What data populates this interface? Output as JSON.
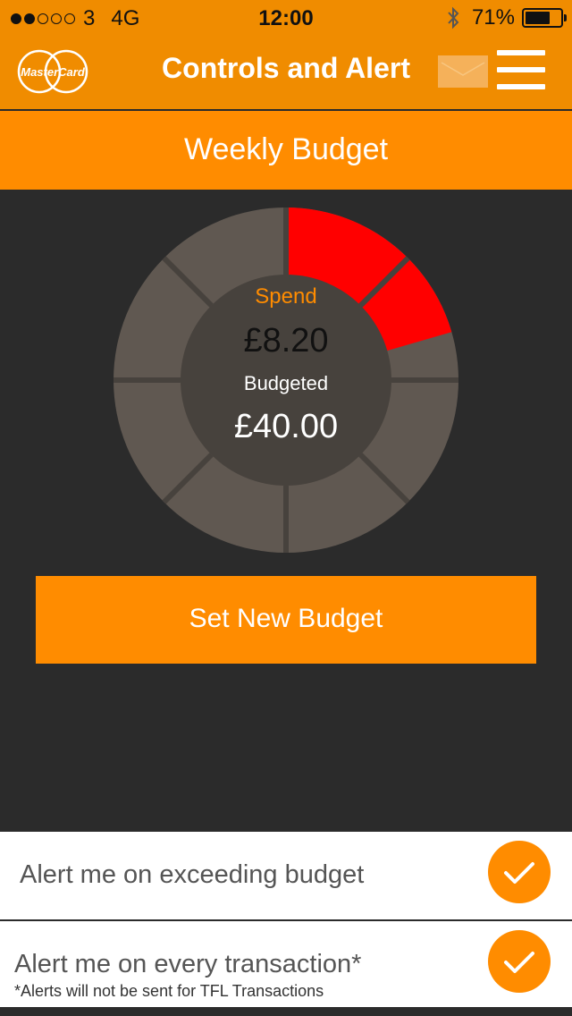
{
  "status_bar": {
    "signal_dots_filled": 2,
    "signal_dots_total": 5,
    "carrier": "3",
    "network": "4G",
    "time": "12:00",
    "battery": "71%",
    "battery_level": 0.71,
    "bluetooth_icon": "bluetooth-icon"
  },
  "header": {
    "logo_text": "MasterCard",
    "title": "Controls and Alert",
    "envelope_icon": "envelope-icon",
    "menu_icon": "hamburger-menu-icon"
  },
  "budget": {
    "section_title": "Weekly Budget",
    "spend_label": "Spend",
    "spend_value": "£8.20",
    "budget_label": "Budgeted",
    "budget_value": "£40.00",
    "spend_fraction": 0.205,
    "colors": {
      "spent": "#ff0000",
      "remaining": "#605851",
      "inner": "#47423d",
      "accent": "#ff8c00"
    }
  },
  "actions": {
    "set_budget_label": "Set New Budget"
  },
  "alerts": [
    {
      "label": "Alert me on exceeding budget",
      "checked": true
    },
    {
      "label": "Alert me on every transaction*",
      "checked": true,
      "note": "*Alerts will not be sent for TFL Transactions"
    }
  ]
}
